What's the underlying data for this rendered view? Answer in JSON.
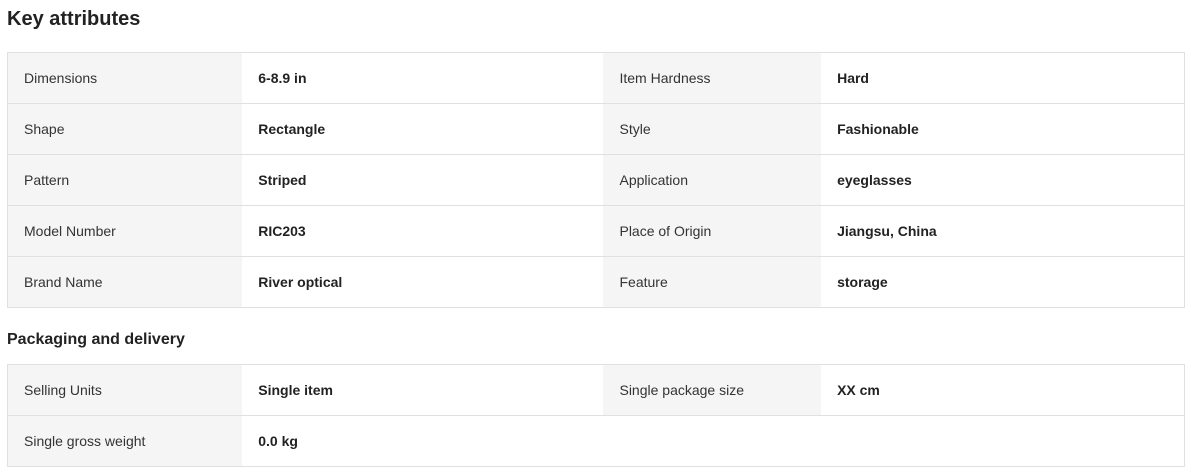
{
  "key_attributes": {
    "title": "Key attributes",
    "rows": [
      {
        "k1": "Dimensions",
        "v1": "6-8.9 in",
        "k2": "Item Hardness",
        "v2": "Hard"
      },
      {
        "k1": "Shape",
        "v1": "Rectangle",
        "k2": "Style",
        "v2": "Fashionable"
      },
      {
        "k1": "Pattern",
        "v1": "Striped",
        "k2": "Application",
        "v2": "eyeglasses"
      },
      {
        "k1": "Model Number",
        "v1": "RIC203",
        "k2": "Place of Origin",
        "v2": "Jiangsu, China"
      },
      {
        "k1": "Brand Name",
        "v1": "River optical",
        "k2": "Feature",
        "v2": "storage"
      }
    ]
  },
  "packaging": {
    "title": "Packaging and delivery",
    "rows": [
      {
        "k1": "Selling Units",
        "v1": "Single item",
        "k2": "Single package size",
        "v2": "XX cm"
      },
      {
        "k1": "Single gross weight",
        "v1": "0.0 kg"
      }
    ]
  }
}
